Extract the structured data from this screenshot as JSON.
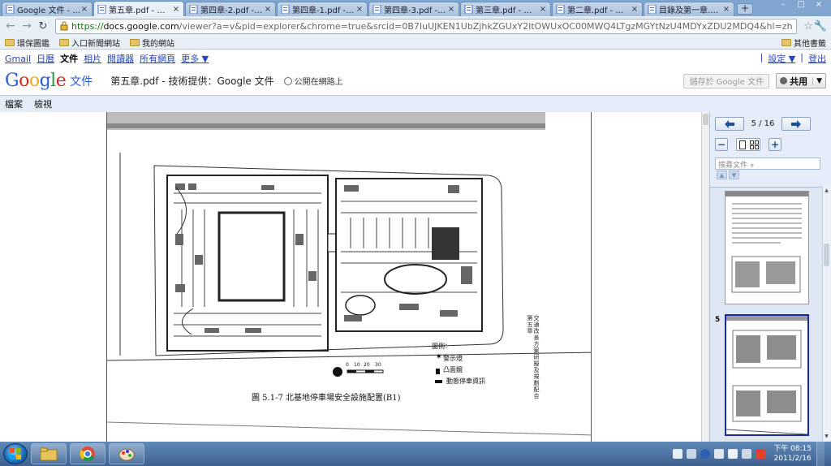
{
  "tabs": [
    {
      "label": "Google 文件 - ...",
      "active": false
    },
    {
      "label": "第五章.pdf - 技...",
      "active": true
    },
    {
      "label": "第四章-2.pdf - ...",
      "active": false
    },
    {
      "label": "第四章-1.pdf - ...",
      "active": false
    },
    {
      "label": "第四章-3.pdf - ...",
      "active": false
    },
    {
      "label": "第三章.pdf - 技...",
      "active": false
    },
    {
      "label": "第二章.pdf - 技...",
      "active": false
    },
    {
      "label": "目錄及第一章.p...",
      "active": false
    }
  ],
  "new_tab_label": "+",
  "close_label": "×",
  "window_controls": [
    "–",
    "□",
    "×"
  ],
  "address": {
    "scheme": "https://",
    "host": "docs.google.com",
    "rest": "/viewer?a=v&pid=explorer&chrome=true&srcid=0B7IuUJKEN1UbZjhkZGUxY2ItOWUxOC00MWQ4LTgzMGYtNzU4MDYxZDU2MDQ4&hl=zh_TW"
  },
  "bookmarks": {
    "items": [
      "環保圖鑑",
      "入口新聞網站",
      "我的網站"
    ],
    "other": "其他書籤"
  },
  "gbar": {
    "links": [
      "Gmail",
      "日曆",
      "文件",
      "相片",
      "閱讀器",
      "所有網頁",
      "更多 ▼"
    ],
    "current": "文件",
    "right": [
      "設定 ▼",
      "登出"
    ]
  },
  "docs": {
    "logo": [
      "G",
      "o",
      "o",
      "g",
      "l",
      "e"
    ],
    "product": "文件",
    "title": "第五章.pdf - 技術提供：Google 文件",
    "public": "公開在網路上",
    "save": "儲存於 Google 文件",
    "share": "共用"
  },
  "menu": [
    "檔案",
    "檢視"
  ],
  "pdf": {
    "caption": "圖 5.1-7  北基地停車場安全設施配置(B1)",
    "legend_title": "圖例：",
    "legend": [
      "警示燈",
      "凸面鏡",
      "動態停車資訊"
    ],
    "scale_labels": [
      "0",
      "10",
      "20",
      "30"
    ],
    "side_text": "交通改善方案研擬及規劃配合",
    "side_chapter": "第五章"
  },
  "viewer": {
    "page_indicator": "5 / 16",
    "search_placeholder": "搜尋文件 »",
    "selected_thumb_number": "5"
  },
  "taskbar": {
    "time": "下午 08:15",
    "date": "2011/2/16"
  },
  "colors": {
    "accent": "#2a5bd7",
    "selected_thumb": "#1a2aa0"
  }
}
